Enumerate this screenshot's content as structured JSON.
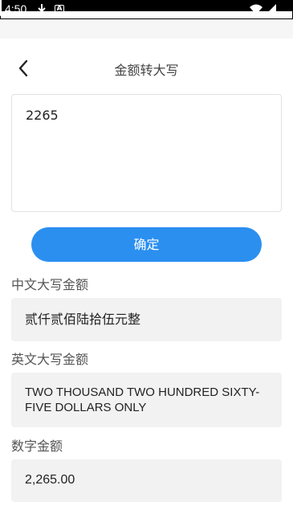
{
  "status_bar": {
    "time": "4:50",
    "icons": [
      "download-icon",
      "a-notification-icon",
      "wifi-icon",
      "signal-icon",
      "battery-icon"
    ]
  },
  "header": {
    "title": "金额转大写",
    "back_icon": "chevron-left-icon"
  },
  "input": {
    "value": "2265"
  },
  "confirm_button": {
    "label": "确定",
    "color": "#2b8ff0"
  },
  "results": {
    "chinese": {
      "label": "中文大写金额",
      "value": "贰仟贰佰陆拾伍元整"
    },
    "english": {
      "label": "英文大写金额",
      "value": "TWO THOUSAND TWO HUNDRED SIXTY-FIVE DOLLARS ONLY"
    },
    "number": {
      "label": "数字金额",
      "value": "2,265.00"
    }
  }
}
